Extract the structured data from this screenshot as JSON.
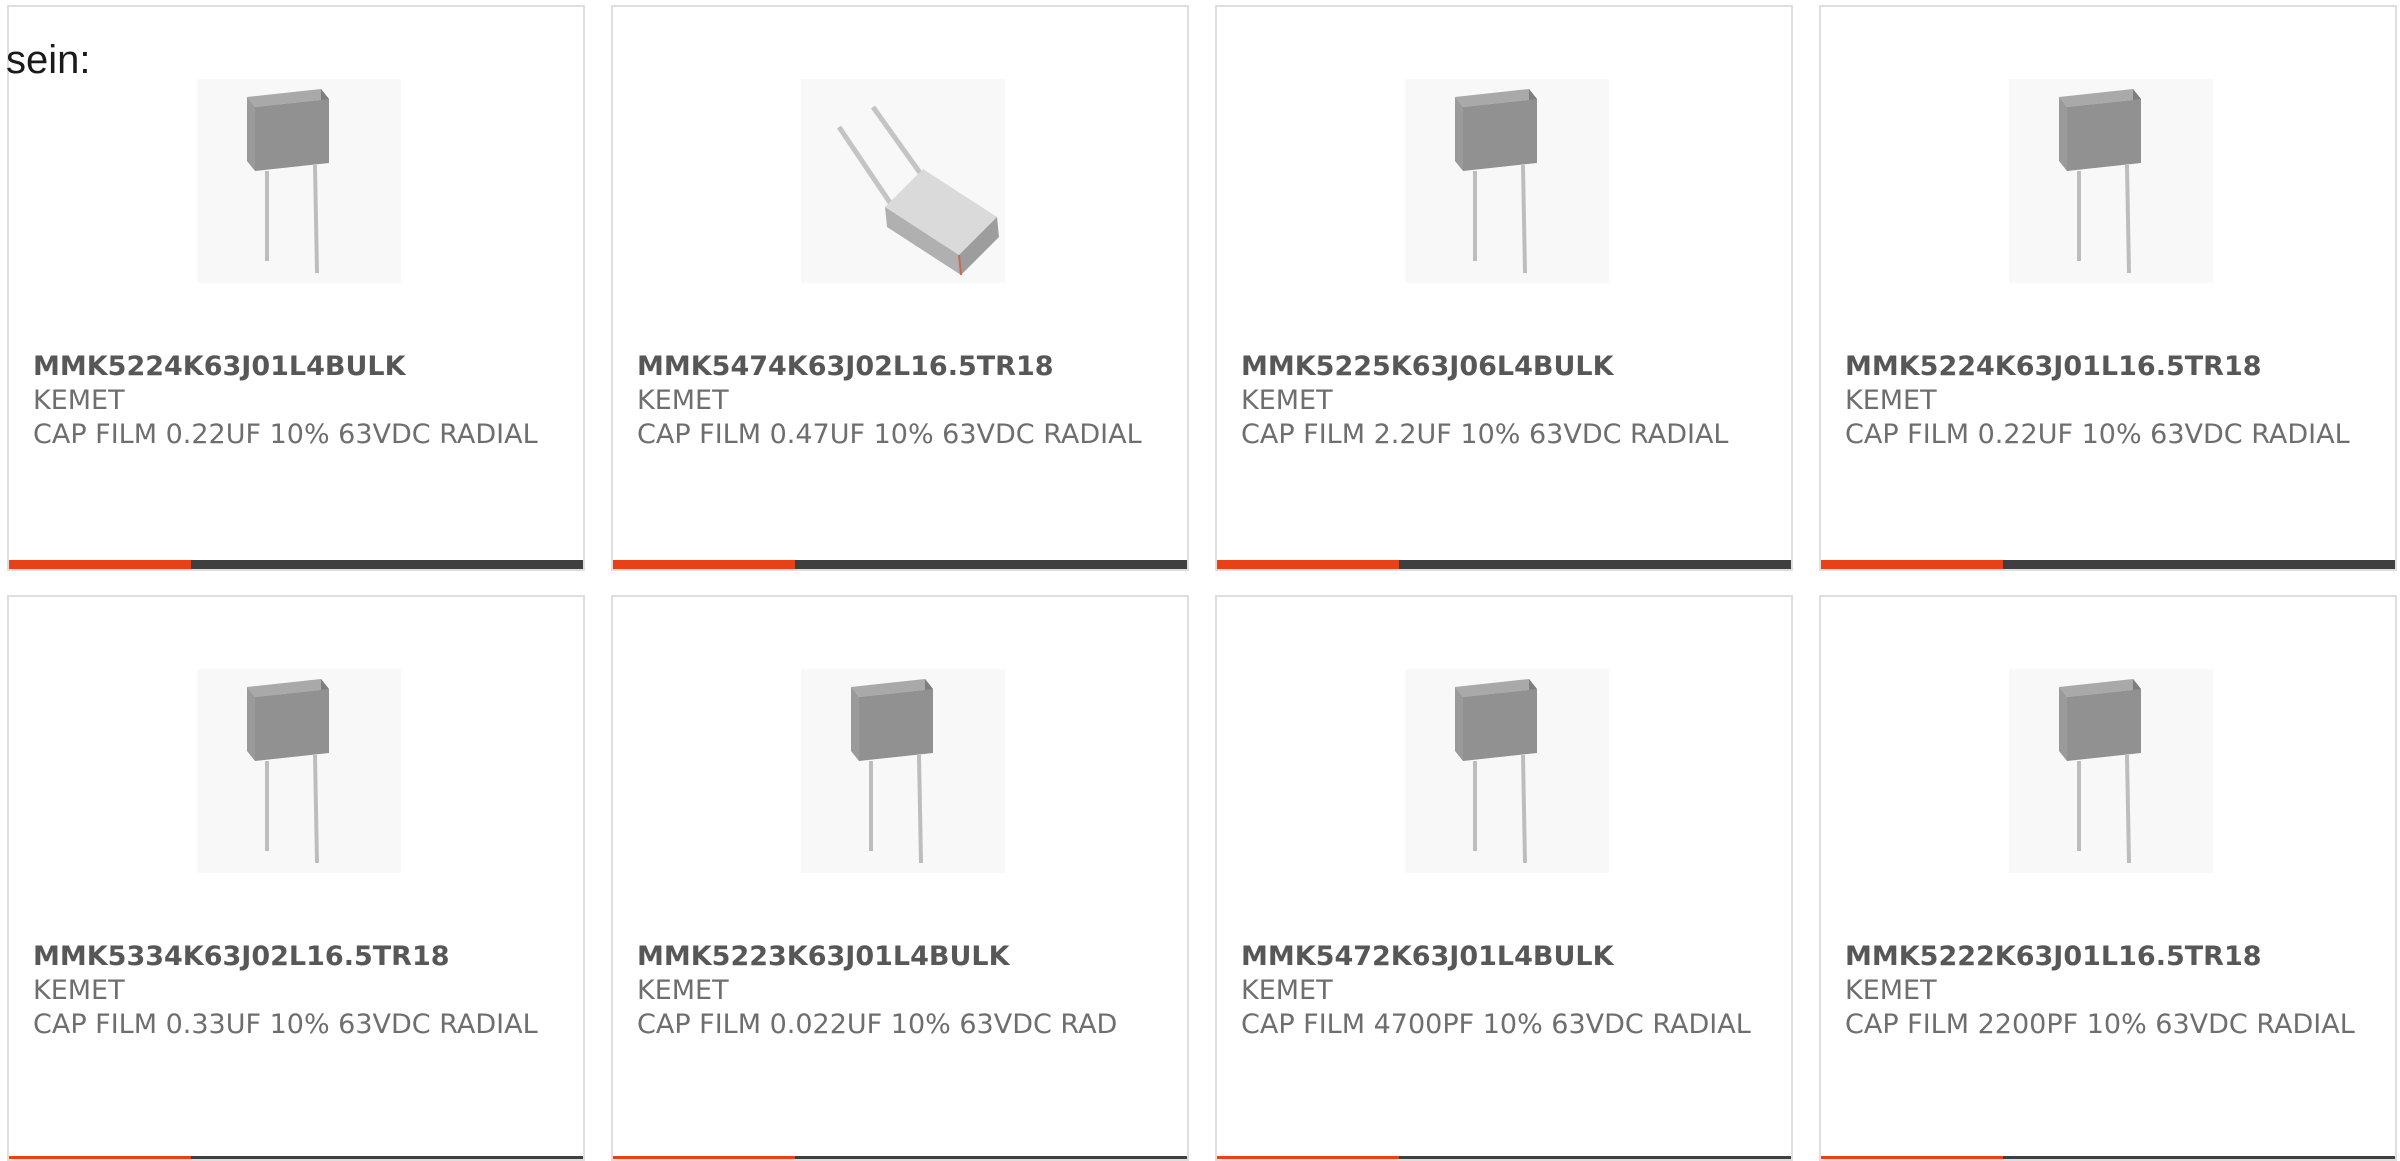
{
  "intro_text": "sein:",
  "colors": {
    "accent": "#e84118",
    "bar_dark": "#3f3f3f",
    "card_border": "#dedede",
    "text": "#6e6e6e"
  },
  "products": [
    {
      "part": "MMK5224K63J01L4BULK",
      "maker": "KEMET",
      "desc": "CAP FILM 0.22UF 10% 63VDC RADIAL",
      "image": "radial-capacitor-upright"
    },
    {
      "part": "MMK5474K63J02L16.5TR18",
      "maker": "KEMET",
      "desc": "CAP FILM 0.47UF 10% 63VDC RADIAL",
      "image": "radial-capacitor-tilted"
    },
    {
      "part": "MMK5225K63J06L4BULK",
      "maker": "KEMET",
      "desc": "CAP FILM 2.2UF 10% 63VDC RADIAL",
      "image": "radial-capacitor-upright"
    },
    {
      "part": "MMK5224K63J01L16.5TR18",
      "maker": "KEMET",
      "desc": "CAP FILM 0.22UF 10% 63VDC RADIAL",
      "image": "radial-capacitor-upright"
    },
    {
      "part": "MMK5334K63J02L16.5TR18",
      "maker": "KEMET",
      "desc": "CAP FILM 0.33UF 10% 63VDC RADIAL",
      "image": "radial-capacitor-upright"
    },
    {
      "part": "MMK5223K63J01L4BULK",
      "maker": "KEMET",
      "desc": "CAP FILM 0.022UF 10% 63VDC RAD",
      "image": "radial-capacitor-upright"
    },
    {
      "part": "MMK5472K63J01L4BULK",
      "maker": "KEMET",
      "desc": "CAP FILM 4700PF 10% 63VDC RADIAL",
      "image": "radial-capacitor-upright"
    },
    {
      "part": "MMK5222K63J01L16.5TR18",
      "maker": "KEMET",
      "desc": "CAP FILM 2200PF 10% 63VDC RADIAL",
      "image": "radial-capacitor-upright"
    }
  ]
}
